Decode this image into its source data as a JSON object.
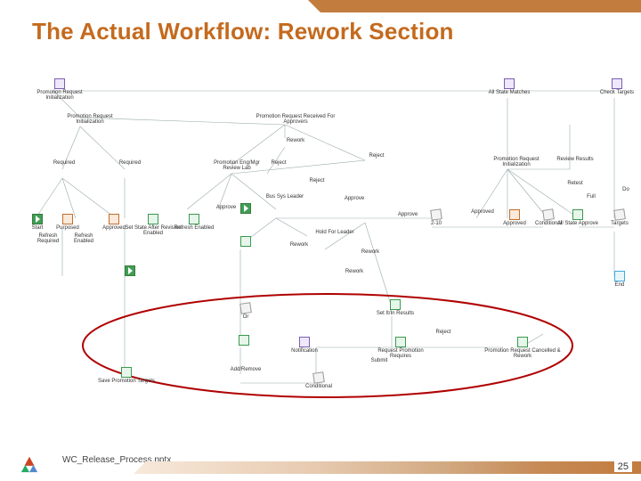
{
  "title": "The Actual Workflow:  Rework Section",
  "footer": {
    "caption": "WC_Release_Process.pptx",
    "page": "25"
  },
  "nodes": {
    "n1": {
      "label": "Promotion Request Initialization"
    },
    "n2": {
      "label": "All State Matches"
    },
    "n3": {
      "label": "Check Targets"
    },
    "n4": {
      "label": "Promotion Request Initialization"
    },
    "n5": {
      "label": "Promotion Request Received For Approvers"
    },
    "n6": {
      "label": "Rework"
    },
    "n7": {
      "label": "Reject"
    },
    "n8": {
      "label": "Reject"
    },
    "n9": {
      "label": "Required"
    },
    "n10": {
      "label": "Required"
    },
    "n11": {
      "label": "Promotion Eng/Mgr Review Lab"
    },
    "n12": {
      "label": "Approve"
    },
    "n13": {
      "label": "Reject"
    },
    "n14": {
      "label": "Bus Sys Leader"
    },
    "n15": {
      "label": "Approve"
    },
    "n16": {
      "label": "Approve"
    },
    "n17": {
      "label": "2-10"
    },
    "n18": {
      "label": "Promotion Request Initialization"
    },
    "n19": {
      "label": "Review Results"
    },
    "n20": {
      "label": "Retest"
    },
    "n21": {
      "label": "Approved"
    },
    "n22": {
      "label": "Purposed"
    },
    "n23": {
      "label": "Approved"
    },
    "n24": {
      "label": "Start"
    },
    "n25": {
      "label": "Refresh Required"
    },
    "n26": {
      "label": "Refresh Enabled"
    },
    "n27": {
      "label": "Set State After Revision Enabled"
    },
    "n28": {
      "label": "Refresh Enabled"
    },
    "n29": {
      "label": "Approved"
    },
    "n30": {
      "label": "Conditional"
    },
    "n31": {
      "label": "All State Approve"
    },
    "n32": {
      "label": "Targets"
    },
    "n33": {
      "label": "Full"
    },
    "n34": {
      "label": "Do"
    },
    "n35": {
      "label": "Rework"
    },
    "n36": {
      "label": "Hold For Leader"
    },
    "n37": {
      "label": "Rework"
    },
    "n38": {
      "label": "Rework"
    },
    "n39": {
      "label": "End"
    },
    "n40": {
      "label": "Or"
    },
    "n41": {
      "label": "Set It/In Results"
    },
    "n42": {
      "label": "Notification"
    },
    "n43": {
      "label": "Reject"
    },
    "n44": {
      "label": "Request Promotion Requires"
    },
    "n45": {
      "label": "Promotion Request Cancelled & Rework"
    },
    "n46": {
      "label": "Save Promotion Targets"
    },
    "n47": {
      "label": "Add/Remove"
    },
    "n48": {
      "label": "Submit"
    },
    "n49": {
      "label": "Conditional"
    }
  }
}
